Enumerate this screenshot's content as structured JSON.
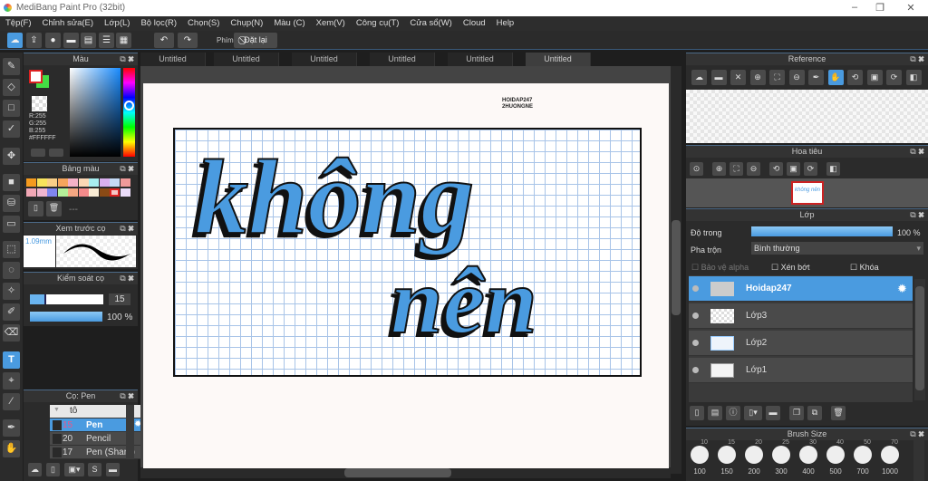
{
  "app": {
    "title": "MediBang Paint Pro (32bit)"
  },
  "menu": [
    "Tệp(F)",
    "Chỉnh sửa(E)",
    "Lớp(L)",
    "Bộ lọc(R)",
    "Chọn(S)",
    "Chụp(N)",
    "Màu (C)",
    "Xem(V)",
    "Công cụ(T)",
    "Cửa sổ(W)",
    "Cloud",
    "Help"
  ],
  "toolbar": {
    "phim_label": "Phím",
    "reset_label": "Đặt lại"
  },
  "tabs": [
    "Untitled",
    "Untitled",
    "Untitled",
    "Untitled",
    "Untitled",
    "Untitled"
  ],
  "active_tab": 5,
  "color_panel": {
    "title": "Màu",
    "r": "R:255",
    "g": "G:255",
    "b": "B:255",
    "hex": "#FFFFFF",
    "primary": "#ffffff",
    "secondary": "#44dd44"
  },
  "palette_panel": {
    "title": "Bảng màu",
    "extra": "---",
    "colors": [
      "#f59a1e",
      "#f8e35c",
      "#f9cf87",
      "#f6a55c",
      "#f5b2c8",
      "#fbd7b5",
      "#a8eef0",
      "#d9b0ee",
      "#c5d9f5",
      "#f09a9a",
      "#f1a7b5",
      "#f0b5cf",
      "#7f86ef",
      "#b5ef99",
      "#f5a782",
      "#f58a8a",
      "#f9ecd5",
      "#8a4a15",
      "#f5c6c6",
      "#eadcf8"
    ]
  },
  "brush_preview": {
    "title": "Xem trước cọ",
    "size": "1.09mm"
  },
  "brush_control": {
    "title": "Kiểm soát cọ",
    "size": "15",
    "opacity": "100 %",
    "size_fraction": 0.22,
    "opacity_fraction": 1.0
  },
  "brush_panel": {
    "title": "Cọ: Pen",
    "group": "tô",
    "items": [
      {
        "size": "15",
        "name": "Pen",
        "selected": true
      },
      {
        "size": "20",
        "name": "Pencil"
      },
      {
        "size": "17",
        "name": "Pen (Sharp)"
      }
    ]
  },
  "canvas": {
    "watermark_line1": "HOIDAP247",
    "watermark_line2": "2HUONGNE",
    "word1": "không",
    "word2": "nên"
  },
  "reference_panel": {
    "title": "Reference"
  },
  "navigator_panel": {
    "title": "Hoa tiêu",
    "thumb_text": "không nên"
  },
  "layer_panel": {
    "title": "Lớp",
    "opacity_label": "Độ trong",
    "opacity_value": "100 %",
    "opacity_fraction": 1.0,
    "blend_label": "Pha trộn",
    "blend_value": "Bình thường",
    "protect_alpha": "Bảo vệ alpha",
    "clipping": "Xén bớt",
    "lock": "Khóa",
    "layers": [
      {
        "name": "Hoidap247",
        "selected": true
      },
      {
        "name": "Lớp3"
      },
      {
        "name": "Lớp2"
      },
      {
        "name": "Lớp1"
      }
    ]
  },
  "brush_size_panel": {
    "title": "Brush Size",
    "top_row": [
      "10",
      "15",
      "20",
      "25",
      "30",
      "40",
      "50",
      "70"
    ],
    "sizes": [
      "100",
      "150",
      "200",
      "300",
      "400",
      "500",
      "700",
      "1000"
    ]
  },
  "accent": "#4a9be0"
}
